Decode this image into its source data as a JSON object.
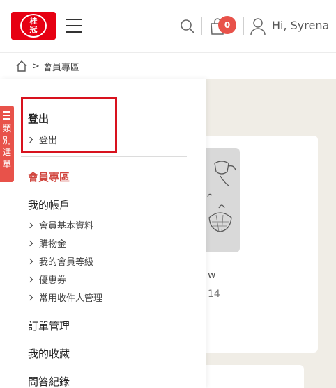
{
  "header": {
    "logo_text_top": "桂",
    "logo_text_bottom": "冠",
    "cart_count": "0",
    "greeting": "Hi, Syrena"
  },
  "breadcrumb": {
    "separator": ">",
    "current": "會員專區"
  },
  "category_tab": {
    "label_chars": [
      "類",
      "別",
      "選",
      "單"
    ]
  },
  "sidebar": {
    "logout_title": "登出",
    "logout_link": "登出",
    "member_section": "會員專區",
    "account_title": "我的帳戶",
    "account_items": [
      "會員基本資料",
      "購物金",
      "我的會員等級",
      "優惠券",
      "常用收件人管理"
    ],
    "orders_title": "訂單管理",
    "favorites_title": "我的收藏",
    "qa_title": "問答紀錄"
  },
  "background": {
    "card_text_1": "w",
    "card_text_2": "14"
  },
  "colors": {
    "brand_red": "#e60012",
    "accent_red": "#e8524a",
    "highlight_border": "#d8121e"
  }
}
